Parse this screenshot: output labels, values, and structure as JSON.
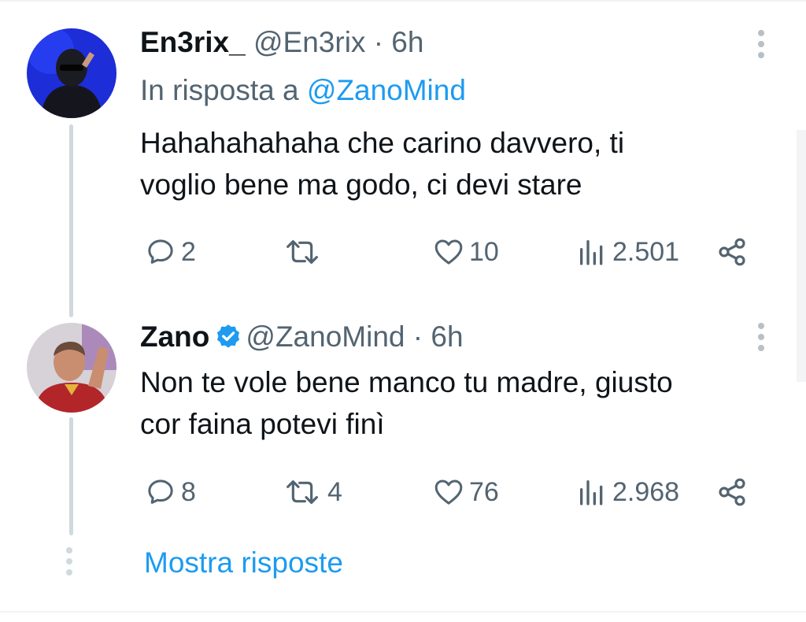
{
  "tweets": [
    {
      "name": "En3rix_",
      "handle": "@En3rix",
      "time": "· 6h",
      "reply_prefix": "In risposta a",
      "reply_mention": "@ZanoMind",
      "text_line1": "Hahahahahaha che carino davvero, ti",
      "text_line2": "voglio bene ma godo, ci devi stare",
      "replies": "2",
      "retweets": "",
      "likes": "10",
      "views": "2.501"
    },
    {
      "name": "Zano",
      "verified": true,
      "handle": "@ZanoMind",
      "time": "· 6h",
      "text_line1": "Non te vole bene manco tu madre, giusto",
      "text_line2": "cor faina potevi finì",
      "replies": "8",
      "retweets": "4",
      "likes": "76",
      "views": "2.968"
    }
  ],
  "show_replies": "Mostra risposte",
  "icons": {
    "reply": "reply-icon",
    "retweet": "retweet-icon",
    "like": "heart-icon",
    "views": "views-icon",
    "share": "share-icon",
    "more": "more-vertical-icon",
    "verified": "verified-badge-icon"
  },
  "colors": {
    "accent": "#1d9bf0",
    "text": "#0f1419",
    "muted": "#536471",
    "thread_line": "#cfd9de"
  }
}
